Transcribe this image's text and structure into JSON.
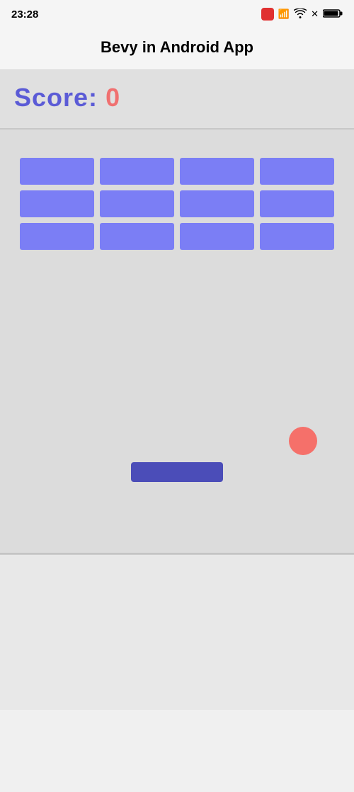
{
  "statusBar": {
    "time": "23:28",
    "icons": [
      "bluetooth",
      "wifi",
      "x",
      "battery"
    ]
  },
  "titleBar": {
    "title": "Bevy in Android App"
  },
  "score": {
    "label": "Score:",
    "value": "0"
  },
  "game": {
    "bricks": [
      {},
      {},
      {},
      {},
      {},
      {},
      {},
      {},
      {},
      {},
      {},
      {}
    ],
    "ball": {
      "color": "#f5706a"
    },
    "paddle": {
      "color": "#4b4db8"
    }
  }
}
